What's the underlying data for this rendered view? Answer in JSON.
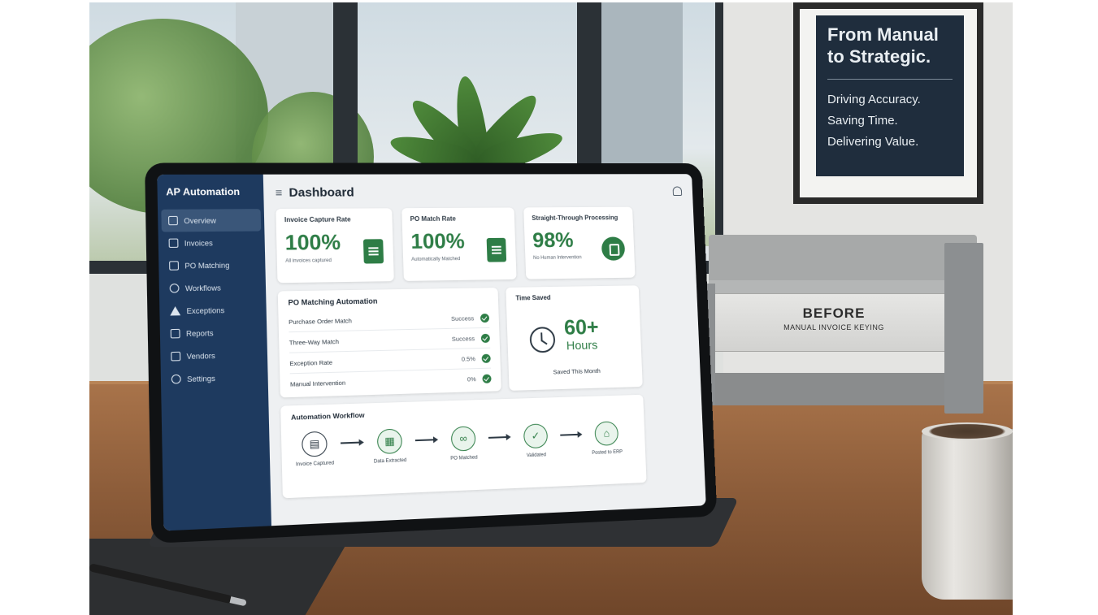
{
  "poster": {
    "title_line1": "From Manual",
    "title_line2": "to Strategic.",
    "lines": [
      "Driving Accuracy.",
      "Saving Time.",
      "Delivering Value."
    ]
  },
  "tray": {
    "label": "BEFORE",
    "sublabel": "MANUAL INVOICE KEYING"
  },
  "app": {
    "brand": "AP Automation",
    "menu_glyph": "≡",
    "page_title": "Dashboard",
    "nav": [
      {
        "label": "Overview",
        "icon": "overview-icon",
        "active": true
      },
      {
        "label": "Invoices",
        "icon": "invoice-icon"
      },
      {
        "label": "PO Matching",
        "icon": "po-matching-icon"
      },
      {
        "label": "Workflows",
        "icon": "workflow-icon"
      },
      {
        "label": "Exceptions",
        "icon": "warning-icon"
      },
      {
        "label": "Reports",
        "icon": "report-icon"
      },
      {
        "label": "Vendors",
        "icon": "vendor-icon"
      },
      {
        "label": "Settings",
        "icon": "gear-icon"
      }
    ],
    "kpis": [
      {
        "label": "Invoice Capture Rate",
        "value": "100%",
        "sub": "All invoices captured",
        "icon": "document-check-icon"
      },
      {
        "label": "PO Match Rate",
        "value": "100%",
        "sub": "Automatically Matched",
        "icon": "document-icon"
      },
      {
        "label": "Straight-Through Processing",
        "value": "98%",
        "sub": "No Human Intervention",
        "icon": "processing-icon"
      }
    ],
    "po_matching": {
      "title": "PO Matching Automation",
      "rows": [
        {
          "name": "Purchase Order Match",
          "status": "Success"
        },
        {
          "name": "Three-Way Match",
          "status": "Success"
        },
        {
          "name": "Exception Rate",
          "status": "0.5%"
        },
        {
          "name": "Manual Intervention",
          "status": "0%"
        }
      ]
    },
    "time_saved": {
      "title": "Time Saved",
      "value": "60+",
      "unit": "Hours",
      "sub": "Saved This Month"
    },
    "workflow": {
      "title": "Automation Workflow",
      "steps": [
        {
          "label": "Invoice Captured",
          "icon": "document-icon",
          "glyph": "▤"
        },
        {
          "label": "Data Extracted",
          "icon": "table-icon",
          "glyph": "▦"
        },
        {
          "label": "PO Matched",
          "icon": "link-icon",
          "glyph": "∞"
        },
        {
          "label": "Validated",
          "icon": "check-icon",
          "glyph": "✓"
        },
        {
          "label": "Posted to ERP",
          "icon": "bank-icon",
          "glyph": "⌂"
        }
      ]
    }
  },
  "colors": {
    "sidebar": "#1e3a5f",
    "accent_green": "#2e7d46",
    "poster_bg": "#1f2d3d"
  }
}
